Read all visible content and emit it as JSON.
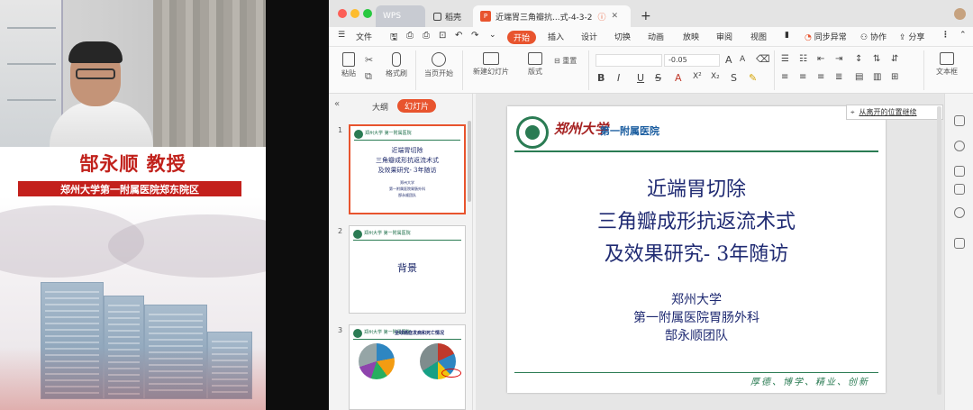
{
  "speaker": {
    "name": "郜永顺 教授",
    "affiliation": "郑州大学第一附属医院郑东院区"
  },
  "window": {
    "tabs": [
      {
        "label": "WPS"
      },
      {
        "label": "稻壳"
      },
      {
        "label": "近端胃三角瓣抗...式-4-3-2"
      }
    ],
    "tab_plus": "+"
  },
  "menu": {
    "file": "文件",
    "items": [
      "开始",
      "插入",
      "设计",
      "切换",
      "动画",
      "放映",
      "审阅",
      "视图"
    ],
    "sync": "同步异常",
    "collab": "协作",
    "share": "分享"
  },
  "toolbar": {
    "paste": "粘贴",
    "format_painter": "格式刷",
    "play_from_current": "当页开始",
    "new_slide": "新建幻灯片",
    "layout": "版式",
    "reset": "重置",
    "font_size_value": "-0.05",
    "text_box": "文本框"
  },
  "left_pane": {
    "tab_outline": "大纲",
    "tab_slides": "幻灯片",
    "thumbs": [
      {
        "num": "1",
        "title": "近端胃切除",
        "line2": "三角瓣成形抗返流术式",
        "line3": "及效果研究- 3年随访",
        "line4": "郑州大学",
        "line5": "第一附属医院胃肠外科",
        "line6": "郜永顺团队"
      },
      {
        "num": "2",
        "title": "背景"
      },
      {
        "num": "3",
        "title": "全球癌症发病和死亡情况"
      }
    ]
  },
  "slide": {
    "university": "郑州大学",
    "hospital": "第一附属医院",
    "title_line1": "近端胃切除",
    "title_line2": "三角瓣成形抗返流术式",
    "title_line3": "及效果研究- 3年随访",
    "sub_line1": "郑州大学",
    "sub_line2": "第一附属医院胃肠外科",
    "sub_line3": "郜永顺团队",
    "motto": "厚德、博学、精业、创新"
  },
  "resume_tip": "从离开的位置继续",
  "colors": {
    "accent": "#e8542e",
    "hospital_green": "#2a7b53",
    "title_navy": "#1f2a72",
    "speaker_red": "#c1211b"
  }
}
